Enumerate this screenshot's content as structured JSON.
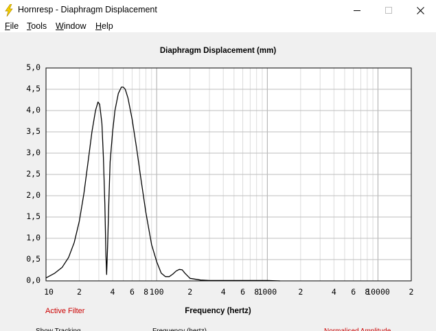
{
  "window": {
    "title": "Hornresp - Diaphragm Displacement",
    "minimize_icon": "minimize-icon",
    "maximize_icon": "maximize-icon",
    "close_icon": "close-icon",
    "app_icon": "lightning-bolt-icon"
  },
  "menu": {
    "items": [
      {
        "label_first": "F",
        "label_rest": "ile"
      },
      {
        "label_first": "T",
        "label_rest": "ools"
      },
      {
        "label_first": "W",
        "label_rest": "indow"
      },
      {
        "label_first": "H",
        "label_rest": "elp"
      }
    ]
  },
  "footer": {
    "active_filter": "Active Filter",
    "partial_left": "Show Tracking",
    "partial_mid": "Frequency (hertz)",
    "partial_right": "Normalised Amplitude"
  },
  "chart_data": {
    "type": "line",
    "title": "Diaphragm Displacement (mm)",
    "xlabel": "Frequency (hertz)",
    "ylabel": "",
    "x_scale": "log",
    "xlim": [
      10,
      20000
    ],
    "ylim": [
      0,
      5
    ],
    "grid": true,
    "y_ticks": [
      "5,0",
      "4,5",
      "4,0",
      "3,5",
      "3,0",
      "2,5",
      "2,0",
      "1,5",
      "1,0",
      "0,5",
      "0,0"
    ],
    "x_ticks": [
      {
        "label": "10",
        "value": 10
      },
      {
        "label": "2",
        "value": 20
      },
      {
        "label": "4",
        "value": 40
      },
      {
        "label": "6",
        "value": 60
      },
      {
        "label": "8",
        "value": 80
      },
      {
        "label": "100",
        "value": 100
      },
      {
        "label": "2",
        "value": 200
      },
      {
        "label": "4",
        "value": 400
      },
      {
        "label": "6",
        "value": 600
      },
      {
        "label": "8",
        "value": 800
      },
      {
        "label": "1000",
        "value": 1000
      },
      {
        "label": "2",
        "value": 2000
      },
      {
        "label": "4",
        "value": 4000
      },
      {
        "label": "6",
        "value": 6000
      },
      {
        "label": "8",
        "value": 8000
      },
      {
        "label": "10000",
        "value": 10000
      },
      {
        "label": "2",
        "value": 20000
      }
    ],
    "series": [
      {
        "color": "#000000",
        "x": [
          10,
          12,
          14,
          16,
          18,
          20,
          22,
          24,
          26,
          28,
          29.5,
          30.5,
          32,
          33,
          34,
          34.8,
          35.3,
          36,
          37,
          38,
          40,
          42,
          45,
          48,
          50,
          52,
          55,
          60,
          66,
          72,
          80,
          90,
          100,
          110,
          120,
          130,
          140,
          150,
          160,
          170,
          180,
          200,
          250,
          300,
          400,
          600,
          1000,
          1300
        ],
        "y": [
          0.07,
          0.18,
          0.32,
          0.55,
          0.9,
          1.4,
          2.05,
          2.8,
          3.5,
          4.0,
          4.2,
          4.15,
          3.7,
          2.9,
          1.8,
          0.6,
          0.15,
          0.8,
          1.9,
          2.8,
          3.5,
          4.0,
          4.4,
          4.55,
          4.55,
          4.5,
          4.3,
          3.8,
          3.1,
          2.4,
          1.6,
          0.85,
          0.45,
          0.18,
          0.1,
          0.1,
          0.16,
          0.23,
          0.27,
          0.26,
          0.18,
          0.06,
          0.02,
          0.01,
          0.01,
          0.01,
          0.01,
          0.0
        ]
      }
    ]
  }
}
